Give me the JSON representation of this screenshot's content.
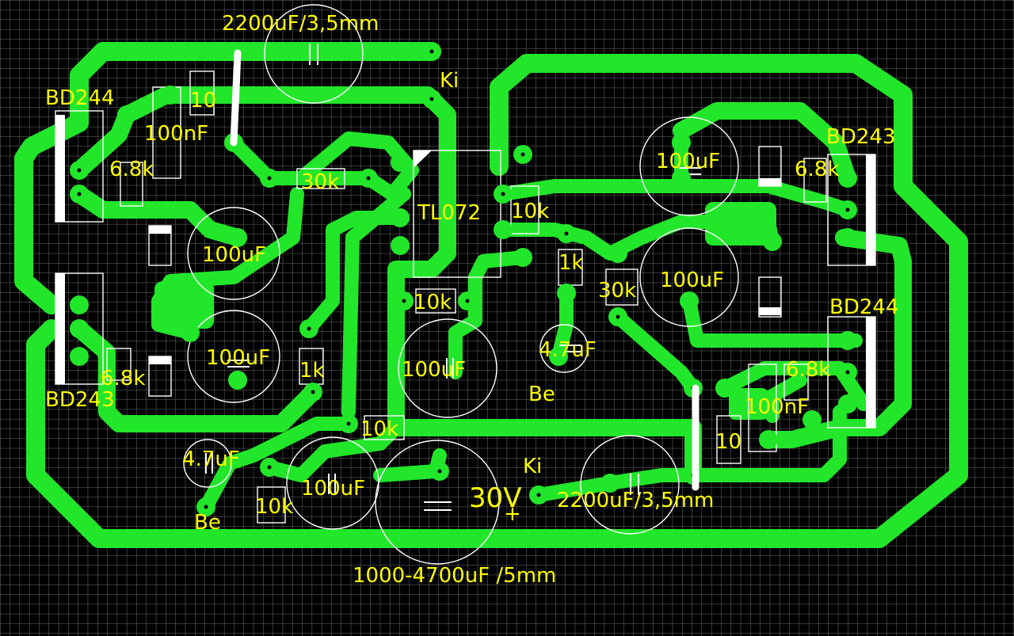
{
  "colors": {
    "background": "#000000",
    "grid": "#6e6e6e",
    "copper": "#22e62a",
    "silkscreen": "#ffffff",
    "labels": "#ffff00"
  },
  "labels": {
    "cap_top": "2200uF/3,5mm",
    "cap_bottom": "2200uF/3,5mm",
    "cap_main": "1000-4700uF /5mm",
    "voltage": "30V",
    "plus": "+",
    "ic": "TL072",
    "bd244_left": "BD244",
    "bd243_left": "BD243",
    "bd243_right": "BD243",
    "bd244_right": "BD244",
    "r10_left": "10",
    "r10_right": "10",
    "c100n_left": "100nF",
    "c100n_right": "100nF",
    "r68k_tl": "6.8k",
    "r68k_bl": "6.8k",
    "r68k_tr": "6.8k",
    "r68k_br": "6.8k",
    "r30k_left": "30k",
    "r30k_right": "30k",
    "c100u_l1": "100uF",
    "c100u_l2": "100uF",
    "c100u_center": "100uF",
    "c100u_bottom": "100uF",
    "c100u_r1": "100uF",
    "c100u_r2": "100uF",
    "r10k_a": "10k",
    "r10k_b": "10k",
    "r10k_c": "10k",
    "r10k_d": "10k",
    "r1k_left": "1k",
    "r1k_right": "1k",
    "c47u_left": "4.7uF",
    "c47u_center": "4.7uF",
    "ki_top": "Ki",
    "ki_bottom": "Ki",
    "be_left": "Be",
    "be_center": "Be"
  }
}
